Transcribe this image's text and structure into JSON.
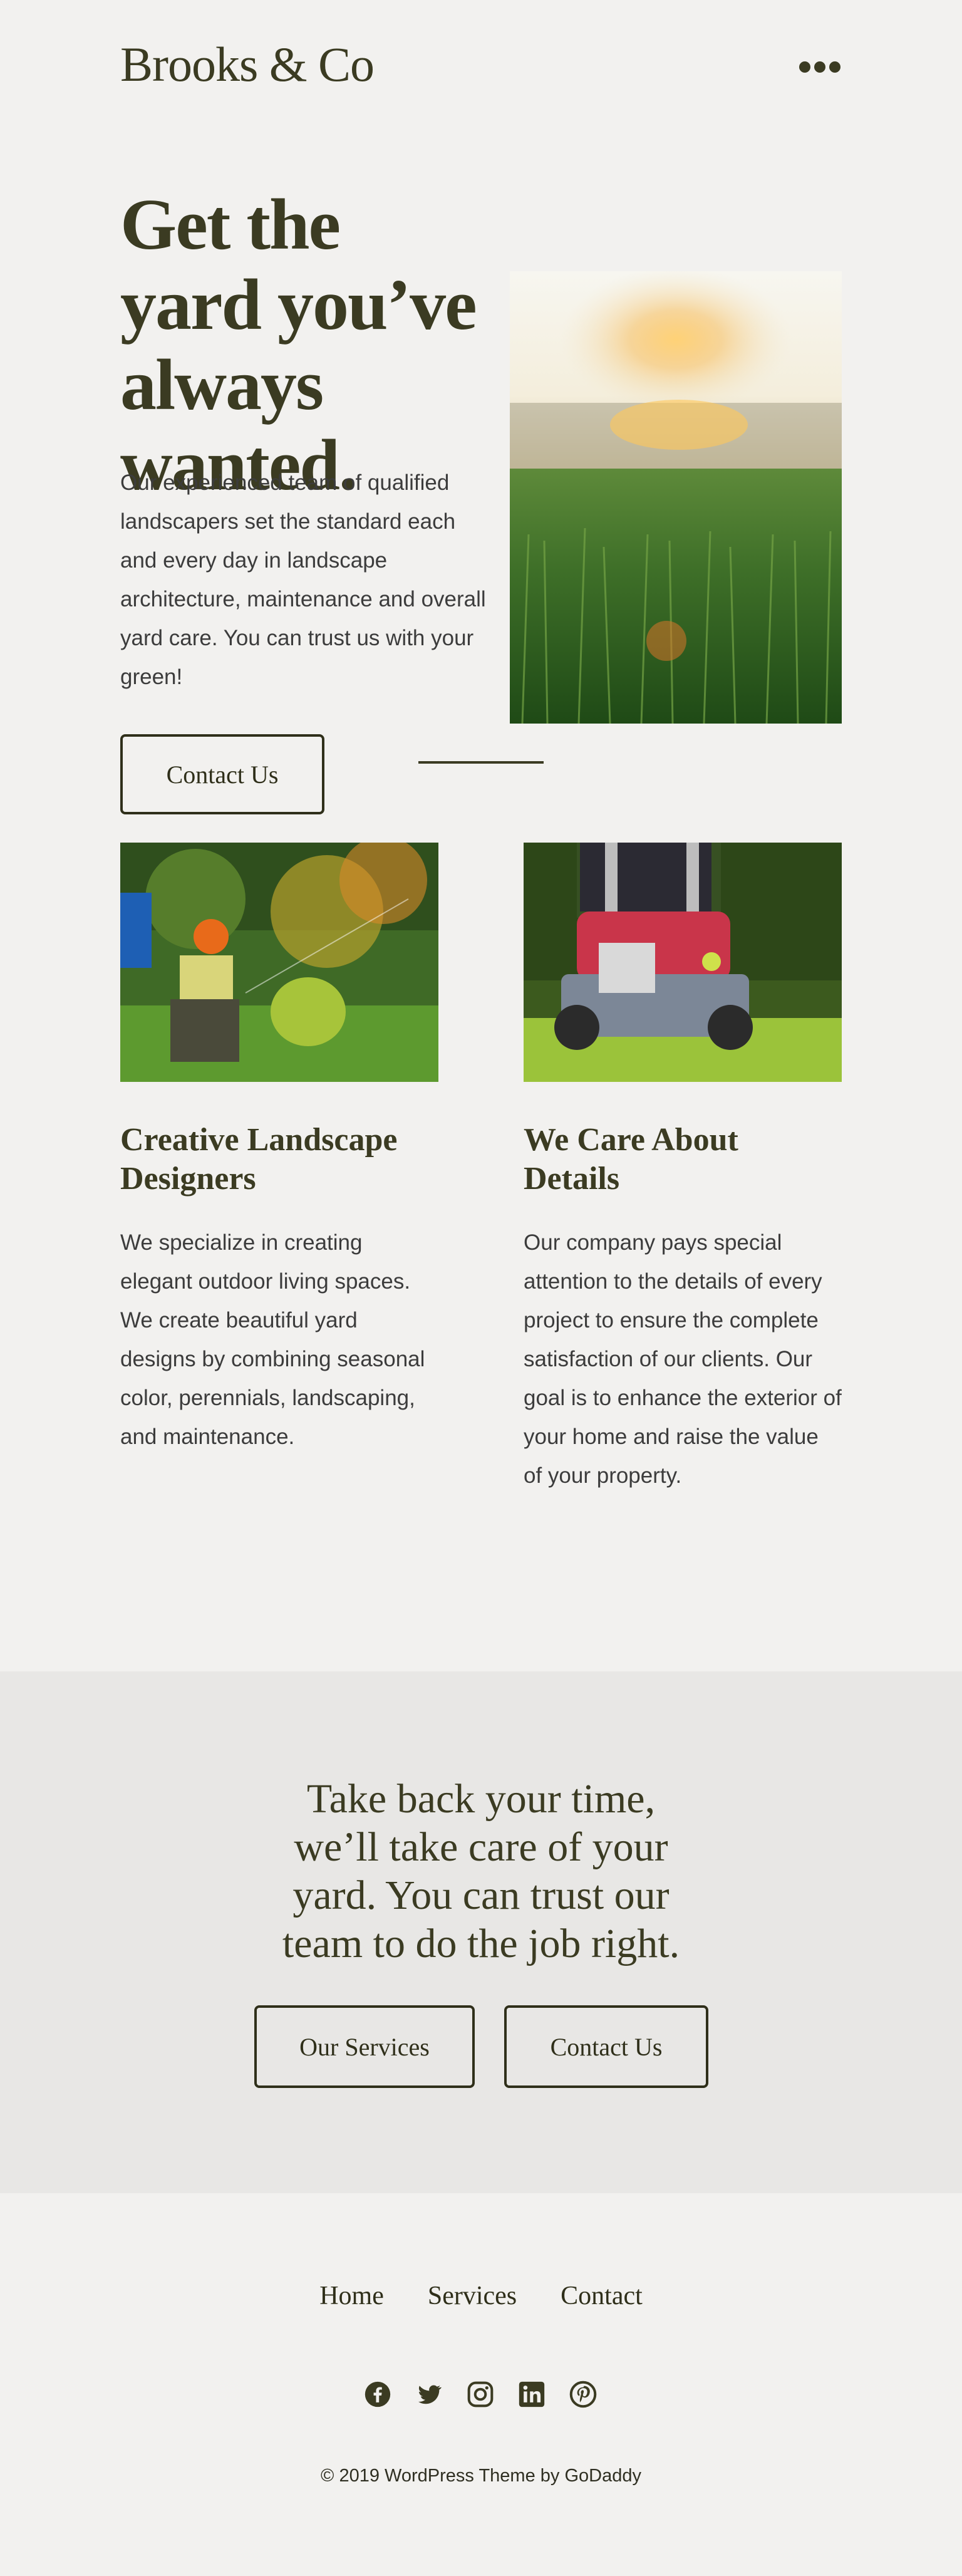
{
  "header": {
    "site_title": "Brooks & Co",
    "menu_icon": "more-horizontal-icon"
  },
  "hero": {
    "title": "Get the yard you’ve always wanted.",
    "text": "Our experienced team of qualified landscapers set the standard each and every day in landscape architecture, maintenance and overall yard care. You can trust us with your green!",
    "button_label": "Contact Us"
  },
  "features": [
    {
      "title": "Creative Landscape Designers",
      "text": "We specialize in creating elegant outdoor living spaces. We create beautiful yard designs by combining seasonal color, perennials, landscaping, and maintenance."
    },
    {
      "title": "We Care About Details",
      "text": "Our company pays special attention to the details of every project to ensure the complete satisfaction of our clients. Our goal is to enhance the exterior of your home and raise the value of your property."
    }
  ],
  "cta": {
    "title": "Take back your time, we’ll take care of your yard. You can trust our team to do the job right.",
    "buttons": [
      "Our Services",
      "Contact Us"
    ]
  },
  "footer": {
    "nav": [
      "Home",
      "Services",
      "Contact"
    ],
    "socials": [
      "facebook-icon",
      "twitter-icon",
      "instagram-icon",
      "linkedin-icon",
      "pinterest-icon"
    ],
    "copyright": "© 2019  WordPress Theme by GoDaddy"
  },
  "colors": {
    "background": "#f2f1ef",
    "band": "#e8e7e5",
    "accent": "#3b3b22"
  }
}
